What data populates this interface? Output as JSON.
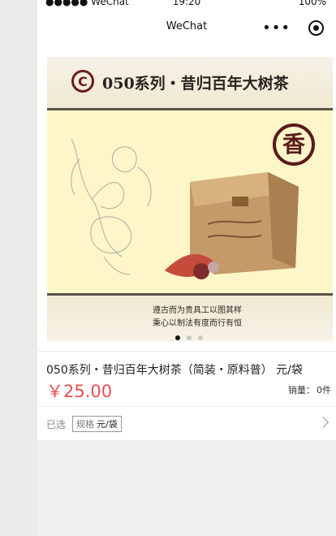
{
  "status_bar": {
    "carrier": "●●●●● WeChat",
    "time": "19:20",
    "battery": "100%"
  },
  "nav": {
    "title": "WeChat",
    "more_icon": "more-dots-icon",
    "target_icon": "target-icon"
  },
  "banner": {
    "title": "050系列・昔归百年大树茶",
    "logo_text": "C",
    "seal_text": "香",
    "caption_line1": "遵古而为贵具工以图其样",
    "caption_line2": "秉心以制法有度而行有恒",
    "active_index": 0,
    "dot_count": 3
  },
  "product": {
    "name": "050系列・昔归百年大树茶（简装・原料普） 元/袋",
    "price": "￥25.00",
    "sales_label": "销量：",
    "sales_value": "0件"
  },
  "spec": {
    "selected_label": "已选",
    "spec_label": "规格",
    "spec_value": "元/袋"
  },
  "colors": {
    "price": "#e94f4f",
    "banner_background": "#fcf6c8"
  }
}
